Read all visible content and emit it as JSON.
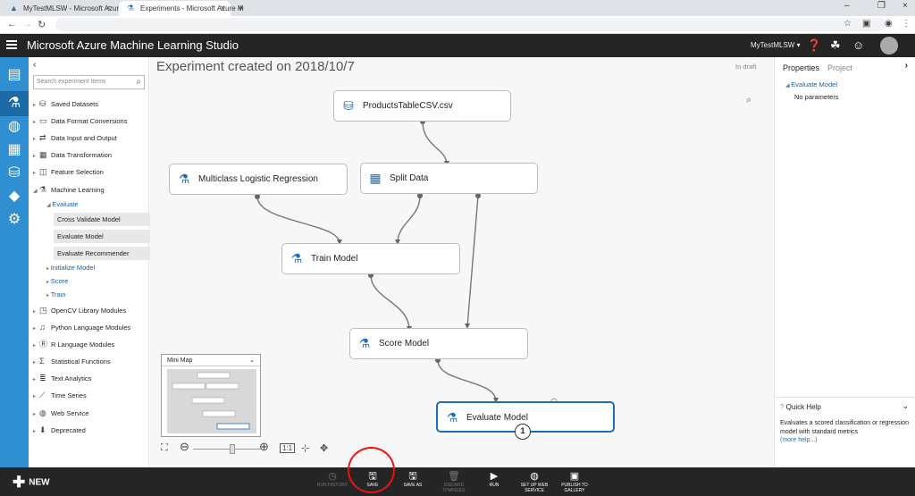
{
  "browser": {
    "tabs": [
      {
        "label": "MyTestMLSW - Microsoft Azure",
        "icon": "azure-icon"
      },
      {
        "label": "Experiments - Microsoft Azure M",
        "icon": "flask-icon"
      }
    ]
  },
  "header": {
    "title": "Microsoft Azure Machine Learning Studio",
    "workspace": "MyTestMLSW"
  },
  "palette": {
    "search_placeholder": "Search experiment items",
    "items": [
      {
        "label": "Saved Datasets"
      },
      {
        "label": "Data Format Conversions"
      },
      {
        "label": "Data Input and Output"
      },
      {
        "label": "Data Transformation"
      },
      {
        "label": "Feature Selection"
      },
      {
        "label": "Machine Learning"
      }
    ],
    "ml_sub": {
      "evaluate": "Evaluate",
      "leaves": [
        "Cross Validate Model",
        "Evaluate Model",
        "Evaluate Recommender"
      ],
      "initialize": "Initialize Model",
      "score": "Score",
      "train": "Train"
    },
    "more_items": [
      {
        "label": "OpenCV Library Modules"
      },
      {
        "label": "Python Language Modules"
      },
      {
        "label": "R Language Modules"
      },
      {
        "label": "Statistical Functions"
      },
      {
        "label": "Text Analytics"
      },
      {
        "label": "Time Series"
      },
      {
        "label": "Web Service"
      },
      {
        "label": "Deprecated"
      }
    ]
  },
  "canvas": {
    "title": "Experiment created on 2018/10/7",
    "status": "In draft",
    "modules": {
      "products": "ProductsTableCSV.csv",
      "multiclass": "Multiclass Logistic Regression",
      "split": "Split Data",
      "train": "Train Model",
      "score": "Score Model",
      "evaluate": "Evaluate Model"
    },
    "badge": "1",
    "minimap_label": "Mini Map",
    "zoom_reset": "1:1"
  },
  "properties": {
    "tab_properties": "Properties",
    "tab_project": "Project",
    "section": "Evaluate Model",
    "no_params": "No parameters",
    "quick_help_title": "Quick Help",
    "quick_help_text": "Evaluates a scored classification or regression model with standard metrics",
    "more_help": "(more help...)"
  },
  "toolbar": {
    "new_label": "NEW",
    "run_history": "RUN HISTORY",
    "save": "SAVE",
    "save_as": "SAVE AS",
    "discard": "DISCARD CHANGES",
    "run": "RUN",
    "setup_ws": "SET UP WEB SERVICE",
    "publish": "PUBLISH TO GALLERY"
  },
  "colors": {
    "accent": "#1e6fb8",
    "nav_bg": "#2f8fd0",
    "header_bg": "#252526",
    "highlight_ring": "#ee1111"
  }
}
